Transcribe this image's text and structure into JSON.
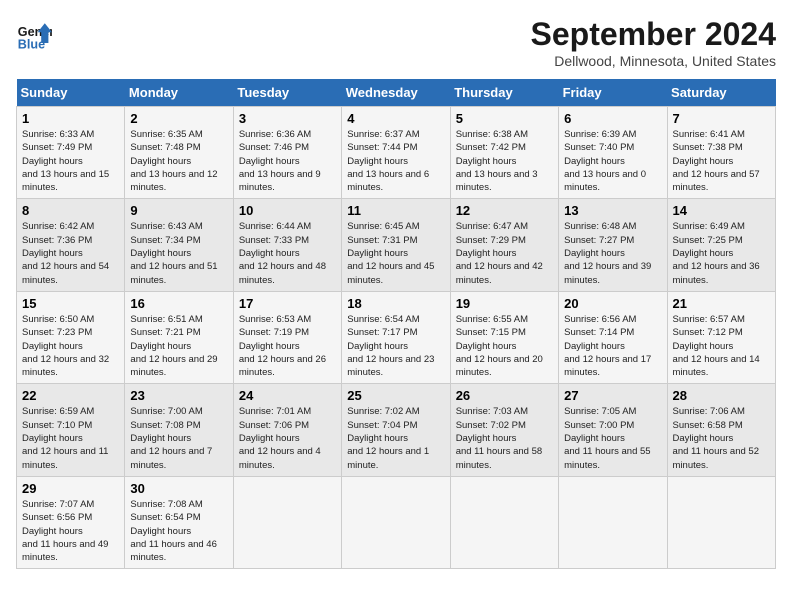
{
  "header": {
    "logo_line1": "General",
    "logo_line2": "Blue",
    "month": "September 2024",
    "location": "Dellwood, Minnesota, United States"
  },
  "days_of_week": [
    "Sunday",
    "Monday",
    "Tuesday",
    "Wednesday",
    "Thursday",
    "Friday",
    "Saturday"
  ],
  "weeks": [
    [
      {
        "day": 1,
        "sunrise": "6:33 AM",
        "sunset": "7:49 PM",
        "daylight": "13 hours and 15 minutes."
      },
      {
        "day": 2,
        "sunrise": "6:35 AM",
        "sunset": "7:48 PM",
        "daylight": "13 hours and 12 minutes."
      },
      {
        "day": 3,
        "sunrise": "6:36 AM",
        "sunset": "7:46 PM",
        "daylight": "13 hours and 9 minutes."
      },
      {
        "day": 4,
        "sunrise": "6:37 AM",
        "sunset": "7:44 PM",
        "daylight": "13 hours and 6 minutes."
      },
      {
        "day": 5,
        "sunrise": "6:38 AM",
        "sunset": "7:42 PM",
        "daylight": "13 hours and 3 minutes."
      },
      {
        "day": 6,
        "sunrise": "6:39 AM",
        "sunset": "7:40 PM",
        "daylight": "13 hours and 0 minutes."
      },
      {
        "day": 7,
        "sunrise": "6:41 AM",
        "sunset": "7:38 PM",
        "daylight": "12 hours and 57 minutes."
      }
    ],
    [
      {
        "day": 8,
        "sunrise": "6:42 AM",
        "sunset": "7:36 PM",
        "daylight": "12 hours and 54 minutes."
      },
      {
        "day": 9,
        "sunrise": "6:43 AM",
        "sunset": "7:34 PM",
        "daylight": "12 hours and 51 minutes."
      },
      {
        "day": 10,
        "sunrise": "6:44 AM",
        "sunset": "7:33 PM",
        "daylight": "12 hours and 48 minutes."
      },
      {
        "day": 11,
        "sunrise": "6:45 AM",
        "sunset": "7:31 PM",
        "daylight": "12 hours and 45 minutes."
      },
      {
        "day": 12,
        "sunrise": "6:47 AM",
        "sunset": "7:29 PM",
        "daylight": "12 hours and 42 minutes."
      },
      {
        "day": 13,
        "sunrise": "6:48 AM",
        "sunset": "7:27 PM",
        "daylight": "12 hours and 39 minutes."
      },
      {
        "day": 14,
        "sunrise": "6:49 AM",
        "sunset": "7:25 PM",
        "daylight": "12 hours and 36 minutes."
      }
    ],
    [
      {
        "day": 15,
        "sunrise": "6:50 AM",
        "sunset": "7:23 PM",
        "daylight": "12 hours and 32 minutes."
      },
      {
        "day": 16,
        "sunrise": "6:51 AM",
        "sunset": "7:21 PM",
        "daylight": "12 hours and 29 minutes."
      },
      {
        "day": 17,
        "sunrise": "6:53 AM",
        "sunset": "7:19 PM",
        "daylight": "12 hours and 26 minutes."
      },
      {
        "day": 18,
        "sunrise": "6:54 AM",
        "sunset": "7:17 PM",
        "daylight": "12 hours and 23 minutes."
      },
      {
        "day": 19,
        "sunrise": "6:55 AM",
        "sunset": "7:15 PM",
        "daylight": "12 hours and 20 minutes."
      },
      {
        "day": 20,
        "sunrise": "6:56 AM",
        "sunset": "7:14 PM",
        "daylight": "12 hours and 17 minutes."
      },
      {
        "day": 21,
        "sunrise": "6:57 AM",
        "sunset": "7:12 PM",
        "daylight": "12 hours and 14 minutes."
      }
    ],
    [
      {
        "day": 22,
        "sunrise": "6:59 AM",
        "sunset": "7:10 PM",
        "daylight": "12 hours and 11 minutes."
      },
      {
        "day": 23,
        "sunrise": "7:00 AM",
        "sunset": "7:08 PM",
        "daylight": "12 hours and 7 minutes."
      },
      {
        "day": 24,
        "sunrise": "7:01 AM",
        "sunset": "7:06 PM",
        "daylight": "12 hours and 4 minutes."
      },
      {
        "day": 25,
        "sunrise": "7:02 AM",
        "sunset": "7:04 PM",
        "daylight": "12 hours and 1 minute."
      },
      {
        "day": 26,
        "sunrise": "7:03 AM",
        "sunset": "7:02 PM",
        "daylight": "11 hours and 58 minutes."
      },
      {
        "day": 27,
        "sunrise": "7:05 AM",
        "sunset": "7:00 PM",
        "daylight": "11 hours and 55 minutes."
      },
      {
        "day": 28,
        "sunrise": "7:06 AM",
        "sunset": "6:58 PM",
        "daylight": "11 hours and 52 minutes."
      }
    ],
    [
      {
        "day": 29,
        "sunrise": "7:07 AM",
        "sunset": "6:56 PM",
        "daylight": "11 hours and 49 minutes."
      },
      {
        "day": 30,
        "sunrise": "7:08 AM",
        "sunset": "6:54 PM",
        "daylight": "11 hours and 46 minutes."
      },
      null,
      null,
      null,
      null,
      null
    ]
  ]
}
